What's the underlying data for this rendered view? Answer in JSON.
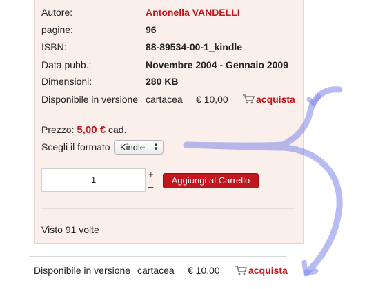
{
  "details": {
    "autore_label": "Autore:",
    "autore_value": "Antonella VANDELLI",
    "pagine_label": "pagine:",
    "pagine_value": "96",
    "isbn_label": "ISBN:",
    "isbn_value": "88-89534-00-1_kindle",
    "data_label": "Data pubb.:",
    "data_value": "Novembre 2004 - Gennaio 2009",
    "dimensioni_label": "Dimensioni:",
    "dimensioni_value": "280 KB"
  },
  "availability_top": {
    "label": "Disponibile in versione",
    "type": "cartacea",
    "price": "€ 10,00",
    "buy_label": "acquista"
  },
  "price": {
    "label": "Prezzo:",
    "value": "5,00 €",
    "unit": "cad."
  },
  "format": {
    "label": "Scegli il formato",
    "selected": "Kindle"
  },
  "quantity": {
    "value": "1",
    "plus": "+",
    "minus": "–"
  },
  "cart_button": {
    "label": "Aggiungi al Carrello"
  },
  "views": {
    "text": "Visto 91 volte"
  },
  "availability_bottom": {
    "label": "Disponibile in versione",
    "type": "cartacea",
    "price": "€ 10,00",
    "buy_label": "acquista"
  },
  "colors": {
    "accent_red": "#c3161c",
    "panel_bg": "#fbefec",
    "annotation_blue": "#7d86e6"
  },
  "icons": {
    "cart": "shopping-cart-icon",
    "select_arrows": "select-arrows-icon"
  }
}
